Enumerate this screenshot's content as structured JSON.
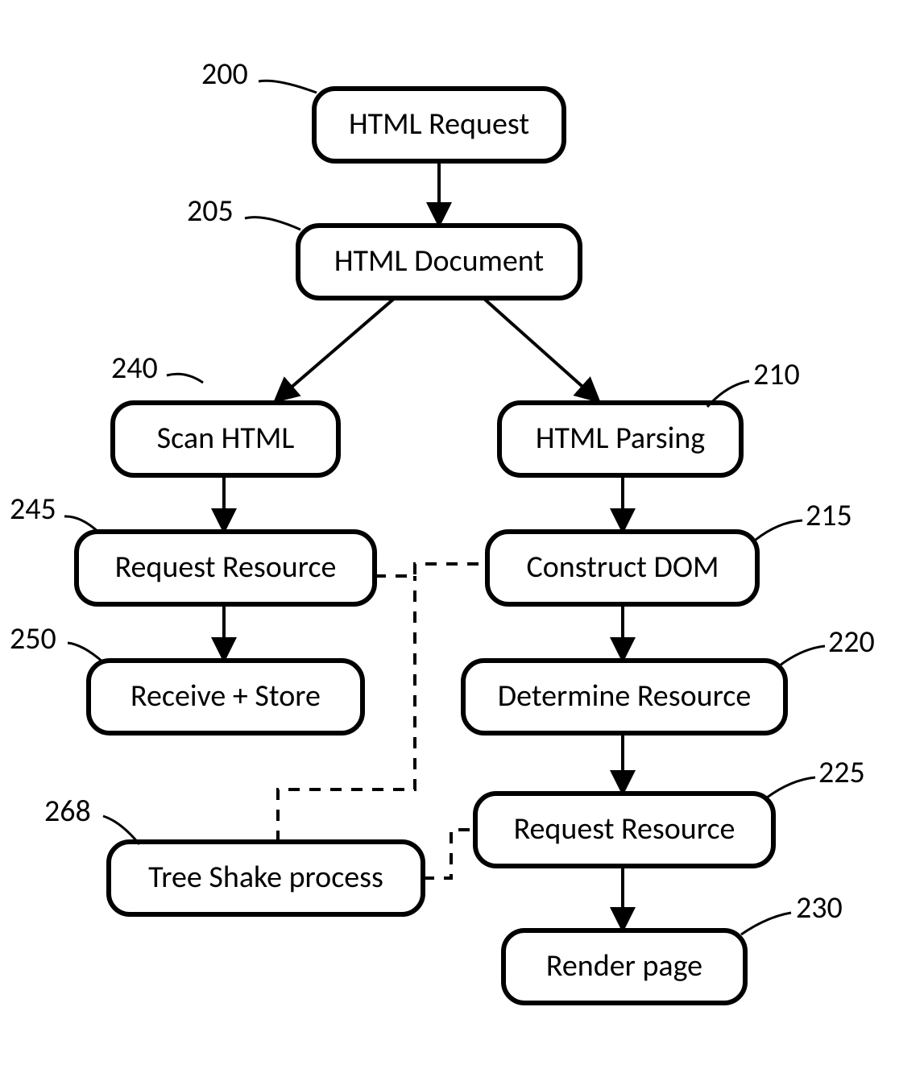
{
  "nodes": {
    "n200": {
      "label": "HTML Request",
      "ref": "200"
    },
    "n205": {
      "label": "HTML Document",
      "ref": "205"
    },
    "n240": {
      "label": "Scan HTML",
      "ref": "240"
    },
    "n210": {
      "label": "HTML Parsing",
      "ref": "210"
    },
    "n245": {
      "label": "Request Resource",
      "ref": "245"
    },
    "n215": {
      "label": "Construct DOM",
      "ref": "215"
    },
    "n250": {
      "label": "Receive + Store",
      "ref": "250"
    },
    "n220": {
      "label": "Determine Resource",
      "ref": "220"
    },
    "n268": {
      "label": "Tree Shake process",
      "ref": "268"
    },
    "n225": {
      "label": "Request Resource",
      "ref": "225"
    },
    "n230": {
      "label": "Render page",
      "ref": "230"
    }
  }
}
